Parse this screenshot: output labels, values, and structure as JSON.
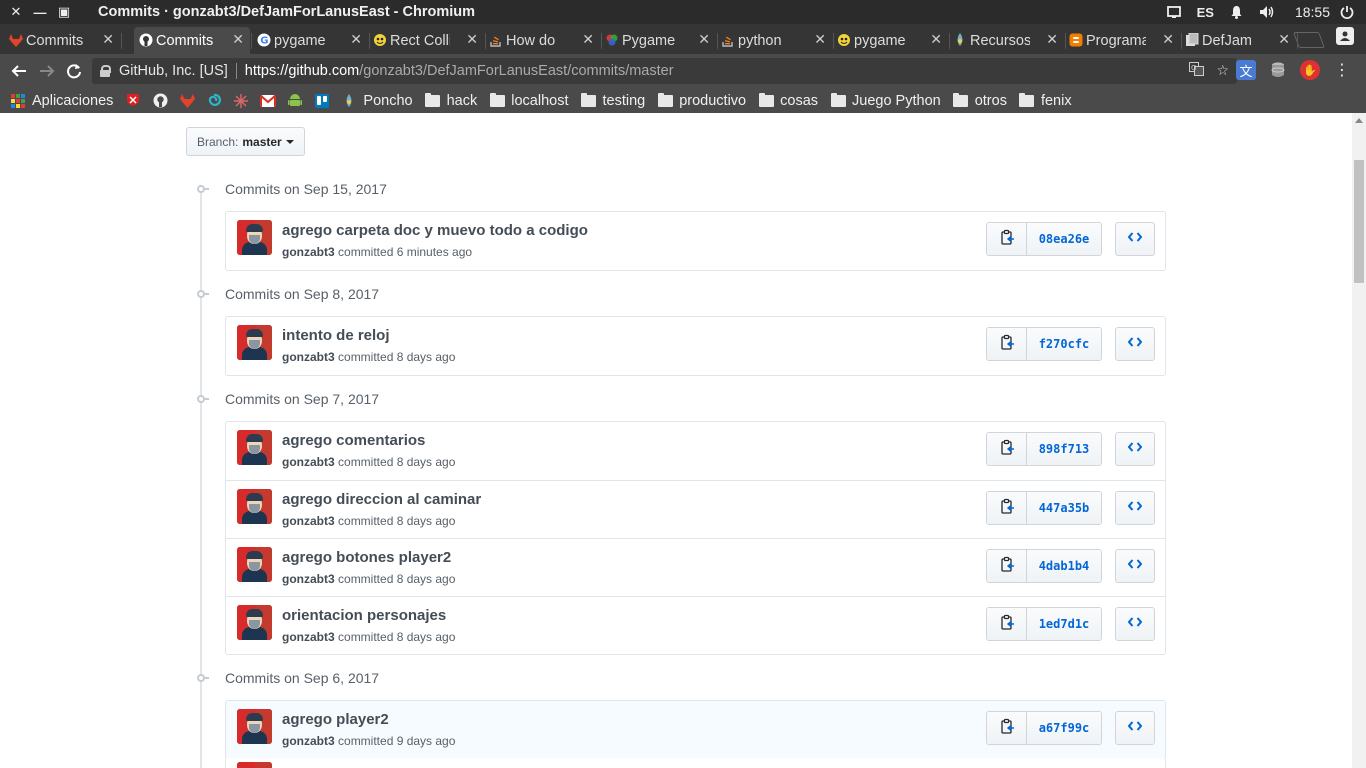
{
  "os": {
    "window_title": "Commits · gonzabt3/DefJamForLanusEast - Chromium",
    "lang": "ES",
    "clock": "18:55"
  },
  "tabs": [
    {
      "label": "Commits",
      "icon": "gitlab-icon",
      "color": "#e24329"
    },
    {
      "label": "Commits",
      "icon": "github-icon",
      "color": "#ffffff",
      "active": true
    },
    {
      "label": "pygame",
      "icon": "google-icon",
      "color": "#4285f4"
    },
    {
      "label": "Rect Collision",
      "icon": "pygame-snake-icon",
      "color": "#f2d33a"
    },
    {
      "label": "How do",
      "icon": "stackoverflow-icon",
      "color": "#f48024"
    },
    {
      "label": "Pygame",
      "icon": "pygame-balls-icon",
      "color": "#5aa0e0"
    },
    {
      "label": "python",
      "icon": "stackoverflow-icon",
      "color": "#f48024"
    },
    {
      "label": "pygame",
      "icon": "pygame-snake-icon",
      "color": "#f2d33a"
    },
    {
      "label": "Recursos",
      "icon": "drop-icon",
      "color": "#6fb3c9"
    },
    {
      "label": "Programa",
      "icon": "blogger-icon",
      "color": "#f57d00"
    },
    {
      "label": "DefJam",
      "icon": "page-icon",
      "color": "#dddddd"
    }
  ],
  "address": {
    "org": "GitHub, Inc. [US]",
    "url_host": "https://github.com",
    "url_path": "/gonzabt3/DefJamForLanusEast/commits/master"
  },
  "bookmarks": [
    {
      "label": "Aplicaciones",
      "icon": "apps-grid-icon"
    },
    {
      "label": "",
      "icon": "independiente-icon"
    },
    {
      "label": "",
      "icon": "github-icon"
    },
    {
      "label": "",
      "icon": "gitlab-icon"
    },
    {
      "label": "",
      "icon": "swirl-icon"
    },
    {
      "label": "",
      "icon": "asterisk-icon"
    },
    {
      "label": "",
      "icon": "gmail-icon"
    },
    {
      "label": "",
      "icon": "android-icon"
    },
    {
      "label": "",
      "icon": "trello-icon"
    },
    {
      "label": "Poncho",
      "icon": "drop-icon"
    },
    {
      "label": "hack",
      "icon": "folder-icon"
    },
    {
      "label": "localhost",
      "icon": "folder-icon"
    },
    {
      "label": "testing",
      "icon": "folder-icon"
    },
    {
      "label": "productivo",
      "icon": "folder-icon"
    },
    {
      "label": "cosas",
      "icon": "folder-icon"
    },
    {
      "label": "Juego Python",
      "icon": "folder-icon"
    },
    {
      "label": "otros",
      "icon": "folder-icon"
    },
    {
      "label": "fenix",
      "icon": "folder-icon"
    }
  ],
  "branch": {
    "label": "Branch:",
    "value": "master"
  },
  "groups": [
    {
      "heading": "Commits on Sep 15, 2017",
      "commits": [
        {
          "title": "agrego carpeta doc y muevo todo a codigo",
          "author": "gonzabt3",
          "meta": "committed 6 minutes ago",
          "sha": "08ea26e"
        }
      ]
    },
    {
      "heading": "Commits on Sep 8, 2017",
      "commits": [
        {
          "title": "intento de reloj",
          "author": "gonzabt3",
          "meta": "committed 8 days ago",
          "sha": "f270cfc"
        }
      ]
    },
    {
      "heading": "Commits on Sep 7, 2017",
      "commits": [
        {
          "title": "agrego comentarios",
          "author": "gonzabt3",
          "meta": "committed 8 days ago",
          "sha": "898f713"
        },
        {
          "title": "agrego direccion al caminar",
          "author": "gonzabt3",
          "meta": "committed 8 days ago",
          "sha": "447a35b"
        },
        {
          "title": "agrego botones player2",
          "author": "gonzabt3",
          "meta": "committed 8 days ago",
          "sha": "4dab1b4"
        },
        {
          "title": "orientacion personajes",
          "author": "gonzabt3",
          "meta": "committed 8 days ago",
          "sha": "1ed7d1c"
        }
      ]
    },
    {
      "heading": "Commits on Sep 6, 2017",
      "commits": [
        {
          "title": "agrego player2",
          "author": "gonzabt3",
          "meta": "committed 9 days ago",
          "sha": "a67f99c"
        }
      ]
    }
  ],
  "colors": {
    "link": "#0366d6",
    "os_bar": "#2b2b2b",
    "toolbar": "#4a4a4a"
  }
}
